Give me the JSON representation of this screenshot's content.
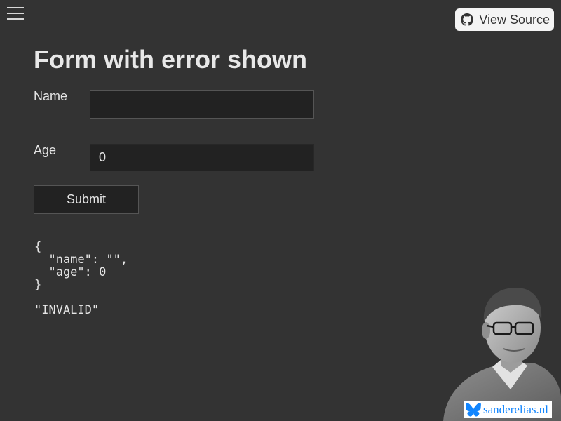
{
  "nav": {
    "menu_icon": "hamburger-icon"
  },
  "header": {
    "view_source_label": "View Source",
    "view_source_icon": "github-icon"
  },
  "page": {
    "title": "Form with error shown"
  },
  "form": {
    "name": {
      "label": "Name",
      "value": ""
    },
    "age": {
      "label": "Age",
      "value": "0"
    },
    "submit_label": "Submit"
  },
  "output": {
    "json": "{\n  \"name\": \"\",\n  \"age\": 0\n}",
    "status": "\"INVALID\""
  },
  "author_badge": {
    "text": "sanderelias.nl",
    "icon": "bluesky-butterfly-icon"
  },
  "colors": {
    "background": "#333333",
    "input_background": "#222222",
    "accent": "#1185fe"
  }
}
